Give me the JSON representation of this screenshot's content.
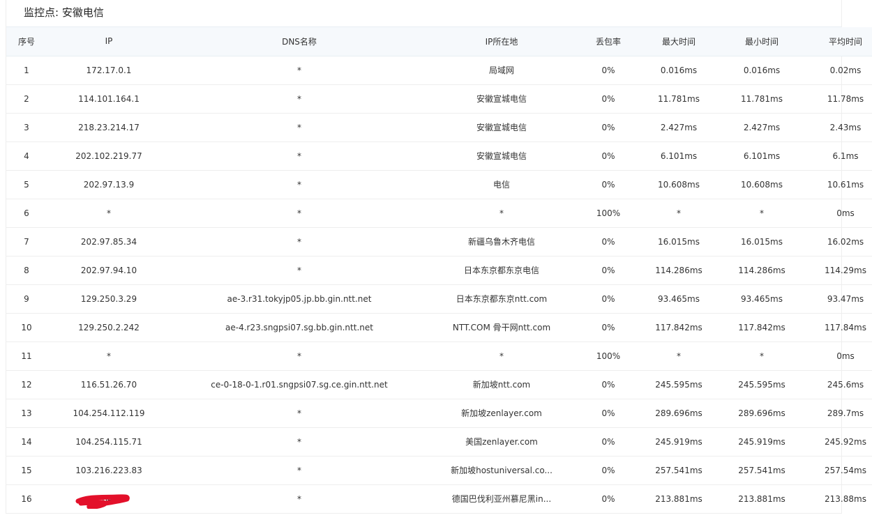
{
  "panel": {
    "title": "监控点: 安徽电信"
  },
  "table": {
    "headers": [
      "序号",
      "IP",
      "DNS名称",
      "IP所在地",
      "丢包率",
      "最大时间",
      "最小时间",
      "平均时间"
    ],
    "rows": [
      [
        "1",
        "172.17.0.1",
        "*",
        "局域网",
        "0%",
        "0.016ms",
        "0.016ms",
        "0.02ms"
      ],
      [
        "2",
        "114.101.164.1",
        "*",
        "安徽宣城电信",
        "0%",
        "11.781ms",
        "11.781ms",
        "11.78ms"
      ],
      [
        "3",
        "218.23.214.17",
        "*",
        "安徽宣城电信",
        "0%",
        "2.427ms",
        "2.427ms",
        "2.43ms"
      ],
      [
        "4",
        "202.102.219.77",
        "*",
        "安徽宣城电信",
        "0%",
        "6.101ms",
        "6.101ms",
        "6.1ms"
      ],
      [
        "5",
        "202.97.13.9",
        "*",
        "电信",
        "0%",
        "10.608ms",
        "10.608ms",
        "10.61ms"
      ],
      [
        "6",
        "*",
        "*",
        "*",
        "100%",
        "*",
        "*",
        "0ms"
      ],
      [
        "7",
        "202.97.85.34",
        "*",
        "新疆乌鲁木齐电信",
        "0%",
        "16.015ms",
        "16.015ms",
        "16.02ms"
      ],
      [
        "8",
        "202.97.94.10",
        "*",
        "日本东京都东京电信",
        "0%",
        "114.286ms",
        "114.286ms",
        "114.29ms"
      ],
      [
        "9",
        "129.250.3.29",
        "ae-3.r31.tokyjp05.jp.bb.gin.ntt.net",
        "日本东京都东京ntt.com",
        "0%",
        "93.465ms",
        "93.465ms",
        "93.47ms"
      ],
      [
        "10",
        "129.250.2.242",
        "ae-4.r23.sngpsi07.sg.bb.gin.ntt.net",
        "NTT.COM 骨干网ntt.com",
        "0%",
        "117.842ms",
        "117.842ms",
        "117.84ms"
      ],
      [
        "11",
        "*",
        "*",
        "*",
        "100%",
        "*",
        "*",
        "0ms"
      ],
      [
        "12",
        "116.51.26.70",
        "ce-0-18-0-1.r01.sngpsi07.sg.ce.gin.ntt.net",
        "新加坡ntt.com",
        "0%",
        "245.595ms",
        "245.595ms",
        "245.6ms"
      ],
      [
        "13",
        "104.254.112.119",
        "*",
        "新加坡zenlayer.com",
        "0%",
        "289.696ms",
        "289.696ms",
        "289.7ms"
      ],
      [
        "14",
        "104.254.115.71",
        "*",
        "美国zenlayer.com",
        "0%",
        "245.919ms",
        "245.919ms",
        "245.92ms"
      ],
      [
        "15",
        "103.216.223.83",
        "*",
        "新加坡hostuniversal.co...",
        "0%",
        "257.541ms",
        "257.541ms",
        "257.54ms"
      ],
      [
        "16",
        "84.",
        "*",
        "德国巴伐利亚州慕尼黑in...",
        "0%",
        "213.881ms",
        "213.881ms",
        "213.88ms"
      ]
    ]
  },
  "colors": {
    "header_bg": "#f6f9fc",
    "border": "#eeeeee",
    "redaction": "#e3102a"
  }
}
